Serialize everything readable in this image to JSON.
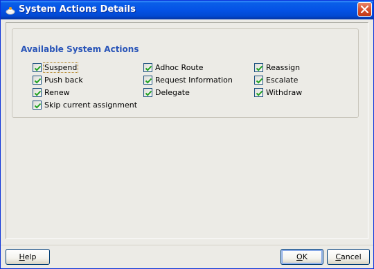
{
  "window": {
    "title": "System Actions Details"
  },
  "group": {
    "title": "Available System Actions"
  },
  "actions": [
    {
      "label": "Suspend",
      "checked": true
    },
    {
      "label": "Push back",
      "checked": true
    },
    {
      "label": "Renew",
      "checked": true
    },
    {
      "label": "Skip current assignment",
      "checked": true
    },
    {
      "label": "Adhoc Route",
      "checked": true
    },
    {
      "label": "Request Information",
      "checked": true
    },
    {
      "label": "Delegate",
      "checked": true
    },
    {
      "label": "Reassign",
      "checked": true
    },
    {
      "label": "Escalate",
      "checked": true
    },
    {
      "label": "Withdraw",
      "checked": true
    }
  ],
  "buttons": {
    "help": {
      "mnemonic": "H",
      "rest": "elp"
    },
    "ok": {
      "mnemonic": "O",
      "rest": "K"
    },
    "cancel": {
      "mnemonic": "C",
      "rest": "ancel"
    }
  },
  "colors": {
    "title_bar": "#0553e6",
    "group_title": "#2a55b8",
    "close": "#d8502c"
  },
  "icons": [
    "app-icon",
    "close-icon",
    "checkmark-icon"
  ]
}
